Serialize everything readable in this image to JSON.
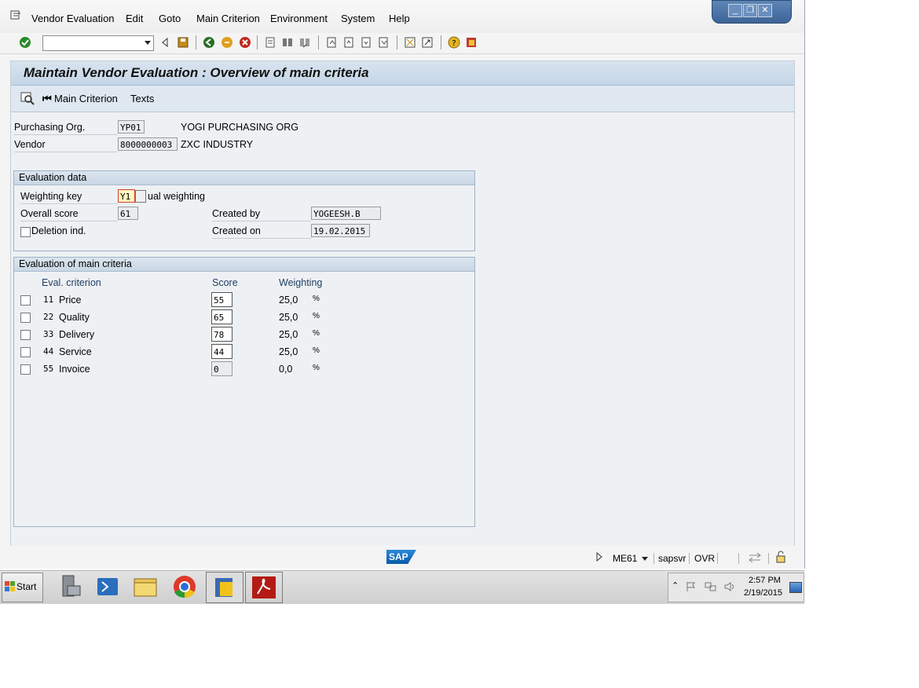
{
  "menubar": {
    "items": [
      "Vendor Evaluation",
      "Edit",
      "Goto",
      "Main Criterion",
      "Environment",
      "System",
      "Help"
    ]
  },
  "screen": {
    "title": "Maintain Vendor Evaluation : Overview of main criteria",
    "app_toolbar": {
      "main_criterion_label": "Main Criterion",
      "texts_label": "Texts"
    }
  },
  "header": {
    "purch_org_label": "Purchasing Org.",
    "purch_org_value": "YP01",
    "purch_org_text": "YOGI PURCHASING ORG",
    "vendor_label": "Vendor",
    "vendor_value": "8000000003",
    "vendor_text": "ZXC INDUSTRY"
  },
  "evaluation_data": {
    "title": "Evaluation data",
    "weighting_key_label": "Weighting key",
    "weighting_key_value": "Y1",
    "weighting_key_text": "ual weighting",
    "overall_score_label": "Overall score",
    "overall_score_value": "61",
    "created_by_label": "Created by",
    "created_by_value": "YOGEESH.B",
    "created_on_label": "Created on",
    "created_on_value": "19.02.2015",
    "deletion_label": "Deletion ind."
  },
  "main_criteria": {
    "title": "Evaluation of main criteria",
    "columns": [
      "Eval. criterion",
      "Score",
      "Weighting"
    ],
    "rows": [
      {
        "num": "11",
        "name": "Price",
        "score": "55",
        "weight": "25,0",
        "unit": "%"
      },
      {
        "num": "22",
        "name": "Quality",
        "score": "65",
        "weight": "25,0",
        "unit": "%"
      },
      {
        "num": "33",
        "name": "Delivery",
        "score": "78",
        "weight": "25,0",
        "unit": "%"
      },
      {
        "num": "44",
        "name": "Service",
        "score": "44",
        "weight": "25,0",
        "unit": "%"
      },
      {
        "num": "55",
        "name": "Invoice",
        "score": "0",
        "weight": "0,0",
        "unit": "%"
      }
    ]
  },
  "status": {
    "logo": "SAP",
    "transaction": "ME61",
    "server": "sapsvr",
    "mode": "OVR"
  },
  "taskbar": {
    "start_label": "Start",
    "time": "2:57 PM",
    "date": "2/19/2015"
  }
}
